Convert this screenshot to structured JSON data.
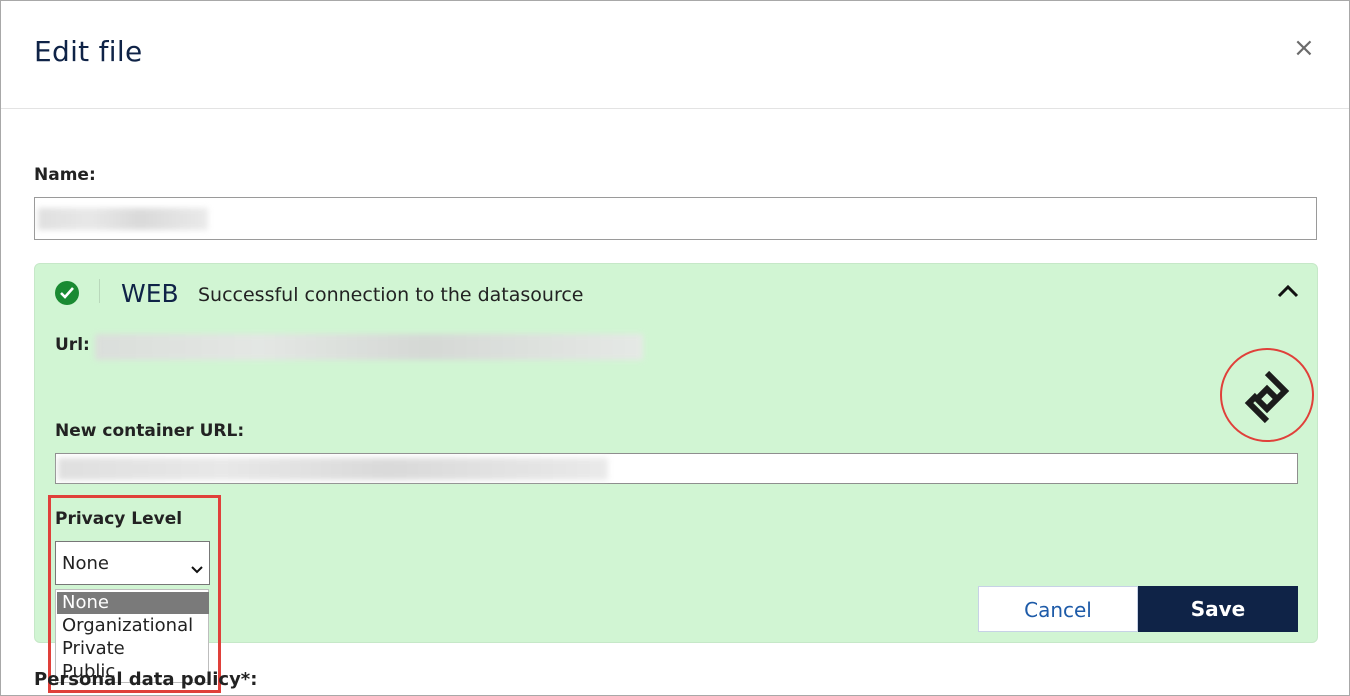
{
  "dialog": {
    "title": "Edit file",
    "close_symbol": "×"
  },
  "form": {
    "name_label": "Name:",
    "name_value": ""
  },
  "datasource": {
    "type": "WEB",
    "status_text": "Successful connection to the datasource",
    "status_color": "#1a8a32",
    "url_label": "Url:",
    "url_value": "",
    "new_container_label": "New container URL:",
    "new_container_value": "",
    "privacy_label": "Privacy Level",
    "privacy_selected": "None",
    "privacy_options": [
      "None",
      "Organizational",
      "Private",
      "Public"
    ],
    "panel_color": "#d1f5d3"
  },
  "actions": {
    "cancel_label": "Cancel",
    "save_label": "Save"
  },
  "below": {
    "policy_label": "Personal data policy*:"
  },
  "colors": {
    "navy": "#0f2347",
    "annotation_red": "#e0403a",
    "link_blue": "#1e5ba8"
  }
}
